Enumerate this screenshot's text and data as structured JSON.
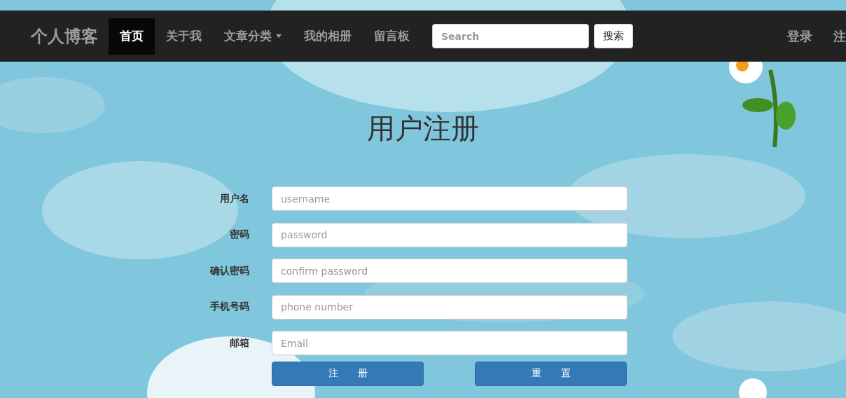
{
  "navbar": {
    "brand": "个人博客",
    "items": [
      {
        "label": "首页",
        "selected": true,
        "dropdown": false
      },
      {
        "label": "关于我",
        "selected": false,
        "dropdown": false
      },
      {
        "label": "文章分类",
        "selected": false,
        "dropdown": true
      },
      {
        "label": "我的相册",
        "selected": false,
        "dropdown": false
      },
      {
        "label": "留言板",
        "selected": false,
        "dropdown": false
      }
    ],
    "search": {
      "placeholder": "Search",
      "button": "搜索"
    },
    "right_links": [
      "登录",
      "注"
    ]
  },
  "form": {
    "title": "用户注册",
    "fields": [
      {
        "label": "用户名",
        "placeholder": "username"
      },
      {
        "label": "密码",
        "placeholder": "password"
      },
      {
        "label": "确认密码",
        "placeholder": "confirm password"
      },
      {
        "label": "手机号码",
        "placeholder": "phone number"
      },
      {
        "label": "邮箱",
        "placeholder": "Email"
      }
    ],
    "buttons": [
      "注　　册",
      "重　　置"
    ]
  }
}
